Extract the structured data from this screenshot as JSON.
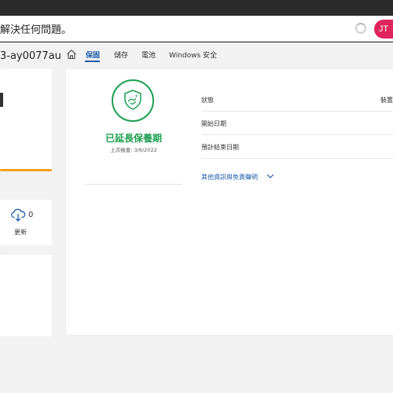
{
  "topbar": {
    "message": "解決任何問題。",
    "avatar_initials": "JT",
    "avatar_color": "#e0245e"
  },
  "device": {
    "name": "3-ay0077au"
  },
  "tabs": [
    {
      "label": "保固",
      "active": true
    },
    {
      "label": "儲存",
      "active": false
    },
    {
      "label": "電池",
      "active": false
    },
    {
      "label": "Windows 安全",
      "active": false
    }
  ],
  "updates": {
    "count": "0",
    "label": "更新"
  },
  "warranty": {
    "status_title": "已延長保養期",
    "last_check": "上次檢查: 3/6/2022",
    "status_color": "#1b9e52",
    "rows": [
      {
        "label": "狀態",
        "value": "裝置"
      },
      {
        "label": "開始日期",
        "value": ""
      },
      {
        "label": "預計結束日期",
        "value": ""
      }
    ],
    "more_link": "其他資訊與免責聲明"
  },
  "icons": [
    "home-icon",
    "shield-check-icon",
    "cloud-download-icon",
    "chevron-down-icon",
    "loading-spinner-icon"
  ]
}
